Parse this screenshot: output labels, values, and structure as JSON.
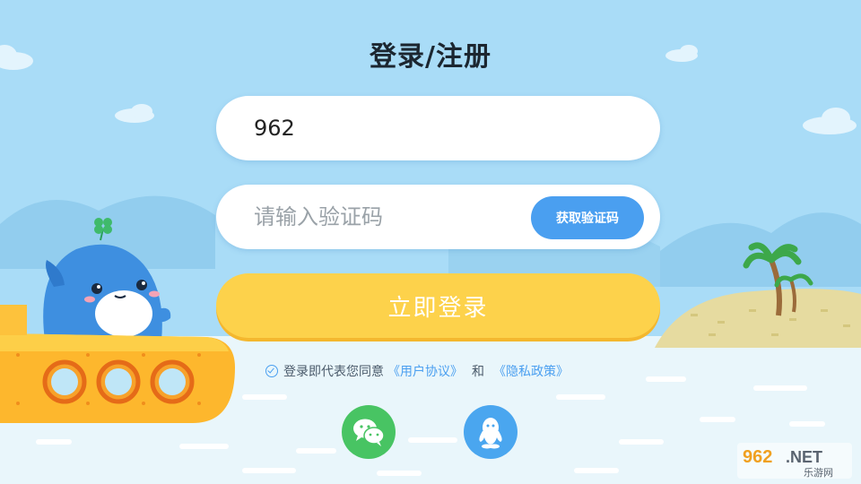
{
  "title": "登录/注册",
  "phone_input": {
    "value": "962"
  },
  "code_input": {
    "placeholder": "请输入验证码"
  },
  "get_code_button": "获取验证码",
  "login_button": "立即登录",
  "agreement": {
    "prefix": "登录即代表您同意",
    "user_agreement": "《用户协议》",
    "joiner": "和",
    "privacy_policy": "《隐私政策》"
  },
  "social": [
    {
      "name": "wechat",
      "icon": "wechat-icon",
      "color": "#48c463"
    },
    {
      "name": "qq",
      "icon": "qq-icon",
      "color": "#4aa6ef"
    }
  ],
  "watermark": {
    "brand": "962",
    "suffix": ".NET",
    "caption": "乐游网"
  },
  "colors": {
    "sky": "#a9dcf7",
    "accent": "#4a9ff0",
    "login": "#fdd24b",
    "ground": "#e9f6fb"
  }
}
